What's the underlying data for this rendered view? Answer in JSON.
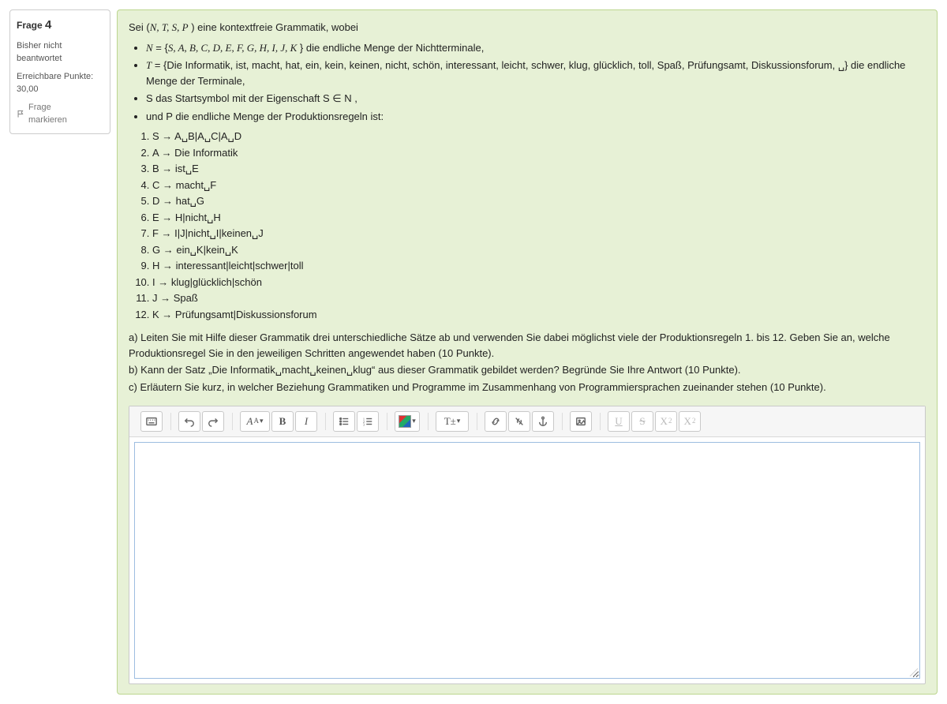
{
  "info": {
    "label": "Frage",
    "number": "4",
    "status_l1": "Bisher nicht",
    "status_l2": "beantwortet",
    "points_label": "Erreichbare Punkte:",
    "points_value": "30,00",
    "flag_l1": "Frage",
    "flag_l2": "markieren"
  },
  "question": {
    "intro_prefix": "Sei (",
    "intro_tuple": "N, T, S, P",
    "intro_suffix": " ) eine kontextfreie Grammatik, wobei",
    "bullets": {
      "b1_pre": "N",
      "b1_mid": " = {",
      "b1_set": "S, A, B, C, D, E, F, G, H, I, J, K",
      "b1_post": " } die endliche Menge der Nichtterminale,",
      "b2_pre": "T",
      "b2_text": " = {Die Informatik, ist, macht, hat, ein, kein, keinen, nicht, schön, interessant, leicht, schwer, klug, glücklich, toll, Spaß, Prüfungsamt, Diskussionsforum, ␣} die endliche Menge der Terminale,",
      "b3": "S das Startsymbol mit der Eigenschaft S ∈ N ,",
      "b4": "und P die endliche Menge der Produktionsregeln ist:"
    },
    "rules": [
      "S → A␣B|A␣C|A␣D",
      "A → Die Informatik",
      "B → ist␣E",
      "C → macht␣F",
      "D → hat␣G",
      "E → H|nicht␣H",
      "F → I|J|nicht␣I|keinen␣J",
      "G → ein␣K|kein␣K",
      "H → interessant|leicht|schwer|toll",
      "I → klug|glücklich|schön",
      "J → Spaß",
      "K → Prüfungsamt|Diskussionsforum"
    ],
    "task_a": "a)  Leiten Sie mit Hilfe dieser Grammatik drei unterschiedliche Sätze ab und verwenden Sie dabei möglichst viele der Produktionsregeln 1. bis 12. Geben Sie an, welche Produktionsregel Sie in den jeweiligen Schritten angewendet haben (10 Punkte).",
    "task_b": "b)  Kann der Satz „Die Informatik␣macht␣keinen␣klug“ aus dieser Grammatik gebildet werden? Begründe Sie Ihre Antwort (10 Punkte).",
    "task_c": "c)  Erläutern Sie kurz, in welcher Beziehung Grammatiken und Programme im Zusammenhang von Programmiersprachen zueinander stehen (10 Punkte)."
  },
  "toolbar": {
    "font_label": "A",
    "font_sub": "A",
    "bold": "B",
    "italic": "I",
    "size_label": "T±",
    "underline": "U",
    "strike": "S",
    "sub": "X",
    "sup": "X"
  }
}
